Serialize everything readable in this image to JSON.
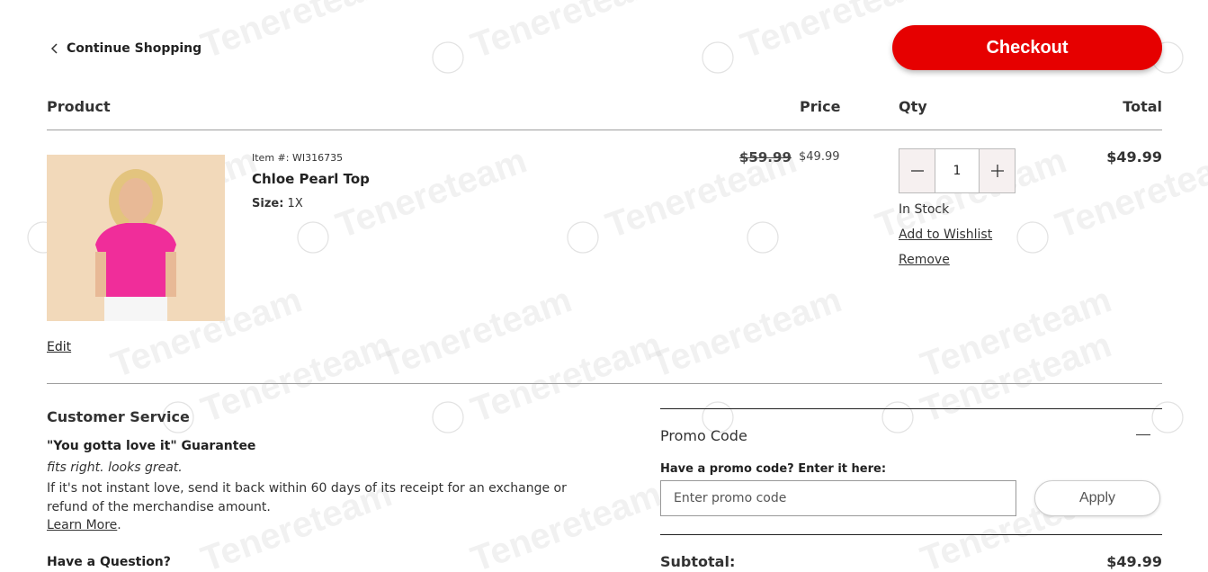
{
  "header": {
    "continue_label": "Continue Shopping",
    "checkout_label": "Checkout"
  },
  "columns": {
    "product": "Product",
    "price": "Price",
    "qty": "Qty",
    "total": "Total"
  },
  "item": {
    "item_number": "Item #: WI316735",
    "name": "Chloe Pearl Top",
    "size_label": "Size:",
    "size_value": "1X",
    "original_price": "$59.99",
    "sale_price": "$49.99",
    "quantity": "1",
    "stock_status": "In Stock",
    "wishlist_label": "Add to Wishlist",
    "remove_label": "Remove",
    "total": "$49.99",
    "edit_label": "Edit"
  },
  "customer_service": {
    "title": "Customer Service",
    "guarantee": "\"You gotta love it\" Guarantee",
    "tagline": "fits right. looks great.",
    "body": "If it's not instant love, send it back within 60 days of its receipt for an exchange or refund of the merchandise amount.",
    "learn_more": "Learn More",
    "learn_more_suffix": ".",
    "question": "Have a Question?"
  },
  "promo": {
    "title": "Promo Code",
    "label": "Have a promo code? Enter it here:",
    "placeholder": "Enter promo code",
    "apply_label": "Apply"
  },
  "summary": {
    "subtotal_label": "Subtotal:",
    "subtotal_value": "$49.99"
  },
  "watermark": "Tenereteam",
  "colors": {
    "accent": "#e60000",
    "text": "#222222",
    "product_top": "#f02d9a",
    "product_bg": "#f2d9ba"
  }
}
